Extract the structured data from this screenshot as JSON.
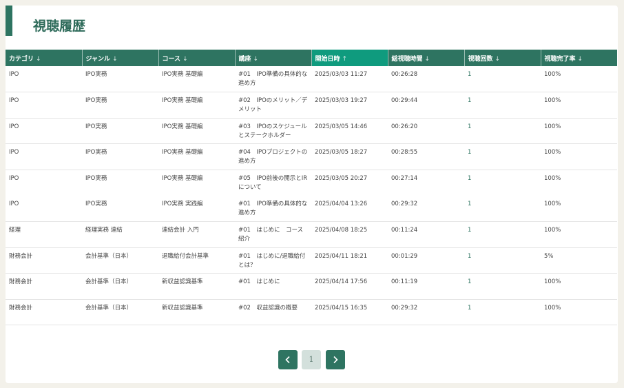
{
  "page": {
    "title": "視聴履歴"
  },
  "table": {
    "columns": [
      {
        "label": "カテゴリ",
        "arrow": "↓"
      },
      {
        "label": "ジャンル",
        "arrow": "↓"
      },
      {
        "label": "コース",
        "arrow": "↓"
      },
      {
        "label": "講座",
        "arrow": "↓"
      },
      {
        "label": "開始日時",
        "arrow": "↑"
      },
      {
        "label": "総視聴時間",
        "arrow": "↓"
      },
      {
        "label": "視聴回数",
        "arrow": "↓"
      },
      {
        "label": "視聴完了率",
        "arrow": "↓"
      }
    ],
    "rows": [
      {
        "category": "IPO",
        "genre": "IPO実務",
        "course": "IPO実務 基礎編",
        "lecture": "#01　IPO準備の具体的な進め方",
        "start": "2025/03/03 11:27",
        "total": "00:26:28",
        "count": "1",
        "rate": "100%"
      },
      {
        "category": "IPO",
        "genre": "IPO実務",
        "course": "IPO実務 基礎編",
        "lecture": "#02　IPOのメリット／デメリット",
        "start": "2025/03/03 19:27",
        "total": "00:29:44",
        "count": "1",
        "rate": "100%"
      },
      {
        "category": "IPO",
        "genre": "IPO実務",
        "course": "IPO実務 基礎編",
        "lecture": "#03　IPOのスケジュールとステークホルダー",
        "start": "2025/03/05 14:46",
        "total": "00:26:20",
        "count": "1",
        "rate": "100%"
      },
      {
        "category": "IPO",
        "genre": "IPO実務",
        "course": "IPO実務 基礎編",
        "lecture": "#04　IPOプロジェクトの進め方",
        "start": "2025/03/05 18:27",
        "total": "00:28:55",
        "count": "1",
        "rate": "100%"
      },
      {
        "category": "IPO",
        "genre": "IPO実務",
        "course": "IPO実務 基礎編",
        "lecture": "#05　IPO前後の開示とIRについて",
        "start": "2025/03/05 20:27",
        "total": "00:27:14",
        "count": "1",
        "rate": "100%"
      },
      {
        "category": "IPO",
        "genre": "IPO実務",
        "course": "IPO実務 実践編",
        "lecture": "#01　IPO準備の具体的な進め方",
        "start": "2025/04/04 13:26",
        "total": "00:29:32",
        "count": "1",
        "rate": "100%"
      },
      {
        "category": "経理",
        "genre": "経理実務 連結",
        "course": "連結会計 入門",
        "lecture": "#01　はじめに　コース紹介",
        "start": "2025/04/08 18:25",
        "total": "00:11:24",
        "count": "1",
        "rate": "100%"
      },
      {
        "category": "財務会計",
        "genre": "会計基準（日本）",
        "course": "退職給付会計基準",
        "lecture": "#01　はじめに/退職給付とは？",
        "start": "2025/04/11 18:21",
        "total": "00:01:29",
        "count": "1",
        "rate": "5%"
      },
      {
        "category": "財務会計",
        "genre": "会計基準（日本）",
        "course": "新収益認識基準",
        "lecture": "#01　はじめに",
        "start": "2025/04/14 17:56",
        "total": "00:11:19",
        "count": "1",
        "rate": "100%"
      },
      {
        "category": "財務会計",
        "genre": "会計基準（日本）",
        "course": "新収益認識基準",
        "lecture": "#02　収益認識の概要",
        "start": "2025/04/15 16:35",
        "total": "00:29:32",
        "count": "1",
        "rate": "100%"
      }
    ]
  },
  "pagination": {
    "current_page": "1",
    "prev_icon": "chevron-left-icon",
    "next_icon": "chevron-right-icon"
  },
  "colors": {
    "primary": "#2e7461",
    "active_header": "#0f9b7e",
    "page_bg": "#f3f1ea"
  }
}
